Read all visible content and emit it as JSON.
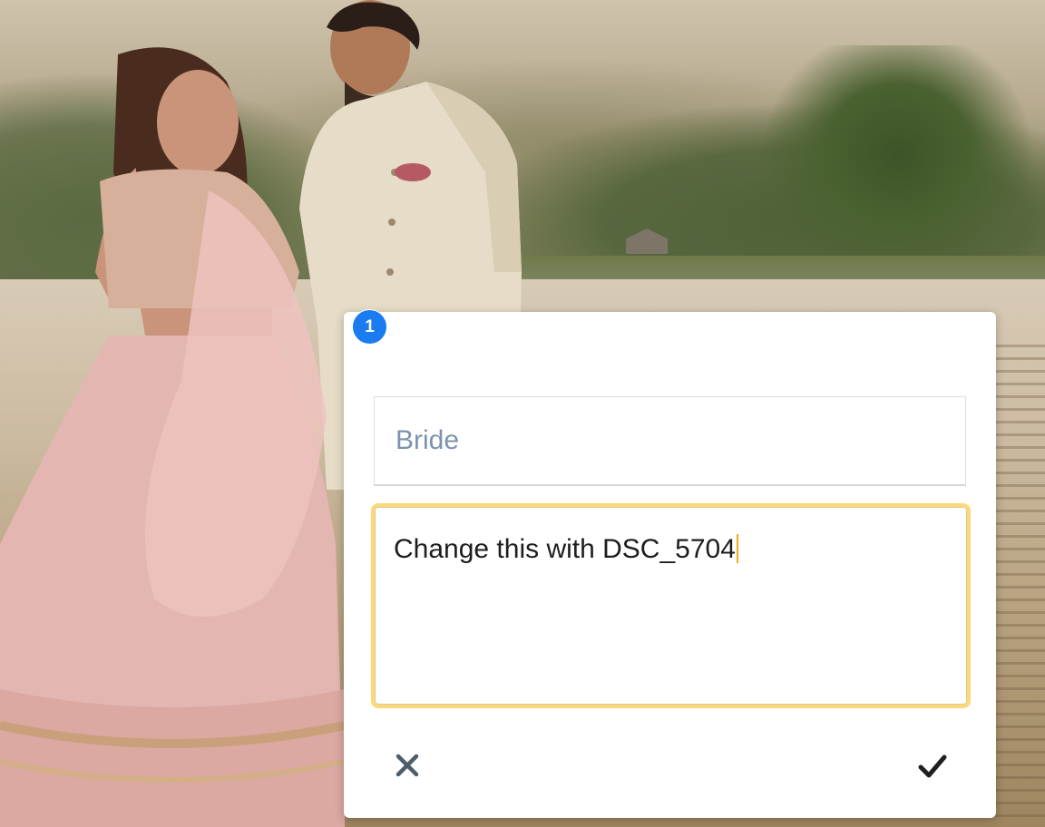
{
  "marker": {
    "number": "1",
    "color": "#1a7cf0"
  },
  "annotation": {
    "label_placeholder": "Bride",
    "comment_text": "Change this with DSC_5704",
    "focus_border_color": "#fbd979"
  },
  "actions": {
    "cancel_icon": "close-icon",
    "confirm_icon": "checkmark-icon"
  }
}
